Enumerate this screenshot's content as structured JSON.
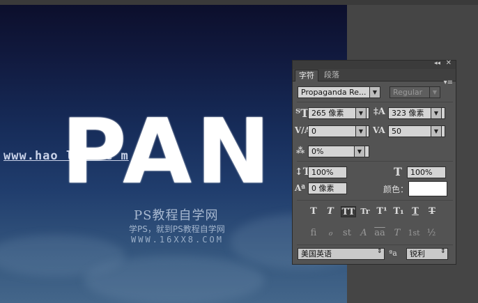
{
  "canvas": {
    "headline": "PAN",
    "watermark_url": "www.hao    li    she    m",
    "watermark_line1": "PS教程自学网",
    "watermark_line2": "学PS，就到PS教程自学网",
    "watermark_line3": "WWW.16XX8.COM"
  },
  "panel": {
    "collapse_icon": "◂◂",
    "close_icon": "✕",
    "tabs": [
      {
        "label": "字符"
      },
      {
        "label": "段落"
      }
    ],
    "menu_icon": "▾≡",
    "font_family": "Propaganda Re...",
    "font_style": "Regular",
    "font_size": "265 像素",
    "leading": "323 像素",
    "kerning": "0",
    "tracking": "50",
    "tsume": "0%",
    "vertical_scale": "100%",
    "horizontal_scale": "100%",
    "baseline_shift": "0 像素",
    "color_label": "颜色：",
    "text_color": "#ffffff",
    "style_buttons": [
      "T",
      "T",
      "TT",
      "Tr",
      "T¹",
      "T₁",
      "T",
      "T"
    ],
    "opentype_buttons": [
      "fi",
      "ℴ",
      "st",
      "A",
      "aa",
      "T",
      "1st",
      "½"
    ],
    "language": "美国英语",
    "aa_icon": "ªa",
    "antialias": "锐利"
  }
}
